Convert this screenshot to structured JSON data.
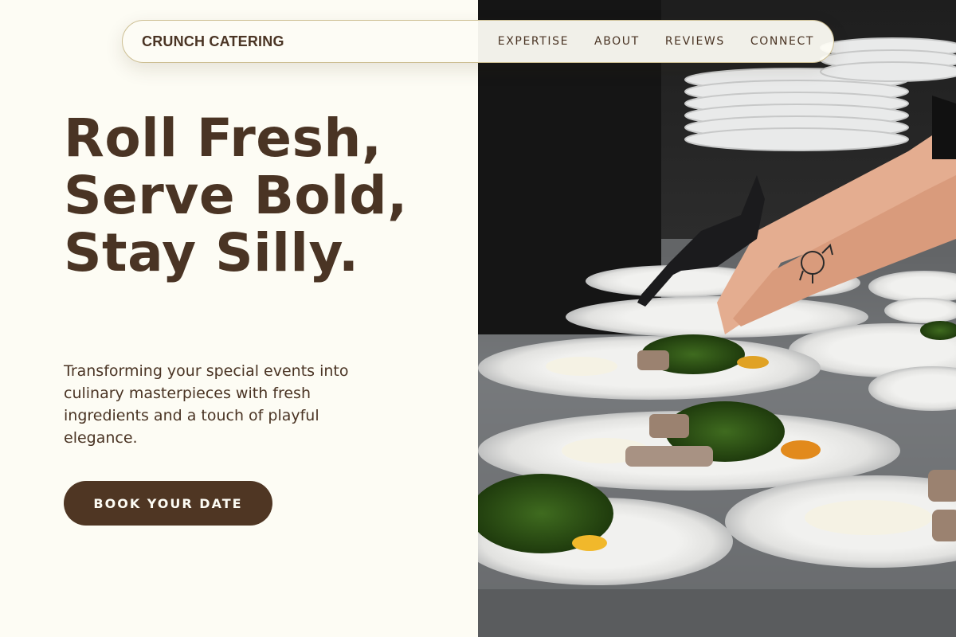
{
  "nav": {
    "brand": "CRUNCH CATERING",
    "links": [
      "EXPERTISE",
      "ABOUT",
      "REVIEWS",
      "CONNECT"
    ]
  },
  "hero": {
    "title": "Roll Fresh, Serve Bold, Stay Silly.",
    "subtitle": "Transforming your special events into culinary masterpieces with fresh ingredients and a touch of playful elegance.",
    "cta_label": "BOOK YOUR DATE",
    "photo_alt": "Chef plating dishes with greens on white plates"
  },
  "colors": {
    "background": "#fdfcf4",
    "text_brown": "#4a3424",
    "button_brown": "#4f3623",
    "nav_border": "#cdbf93"
  }
}
